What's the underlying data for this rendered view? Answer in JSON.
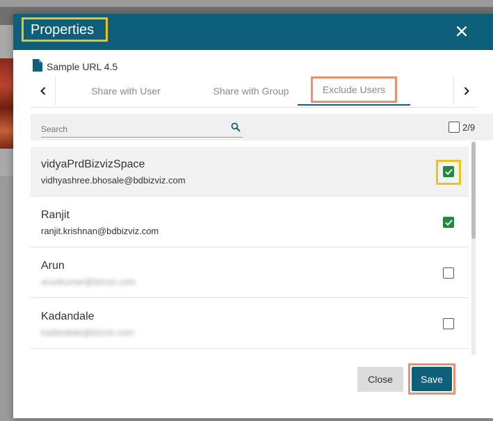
{
  "dialog": {
    "title": "Properties",
    "close_icon": "close-icon",
    "file": {
      "icon": "document-icon",
      "name": "Sample URL 4.5"
    }
  },
  "tabs": {
    "prev_icon": "chevron-left-icon",
    "next_icon": "chevron-right-icon",
    "items": [
      {
        "label": "Share with User"
      },
      {
        "label": "Share with Group"
      },
      {
        "label": "Exclude Users",
        "active": true
      }
    ]
  },
  "search": {
    "placeholder": "Search",
    "icon": "search-icon"
  },
  "selection": {
    "count": "2/9",
    "all_selected": false
  },
  "users": [
    {
      "name": "vidyaPrdBizvizSpace",
      "email": "vidhyashree.bhosale@bdbizviz.com",
      "checked": true
    },
    {
      "name": "Ranjit",
      "email": "ranjit.krishnan@bdbizviz.com",
      "checked": true
    },
    {
      "name": "Arun",
      "email": "arunkumar@bizviz.com",
      "checked": false,
      "email_obscured": true
    },
    {
      "name": "Kadandale",
      "email": "kadandale@bizviz.com",
      "checked": false,
      "email_obscured": true
    }
  ],
  "footer": {
    "close_label": "Close",
    "save_label": "Save"
  },
  "colors": {
    "header": "#0e5f7a",
    "checkbox_checked": "#1e8c3a",
    "highlight_yellow": "#f2c21b",
    "highlight_orange": "#ef8f6a"
  }
}
